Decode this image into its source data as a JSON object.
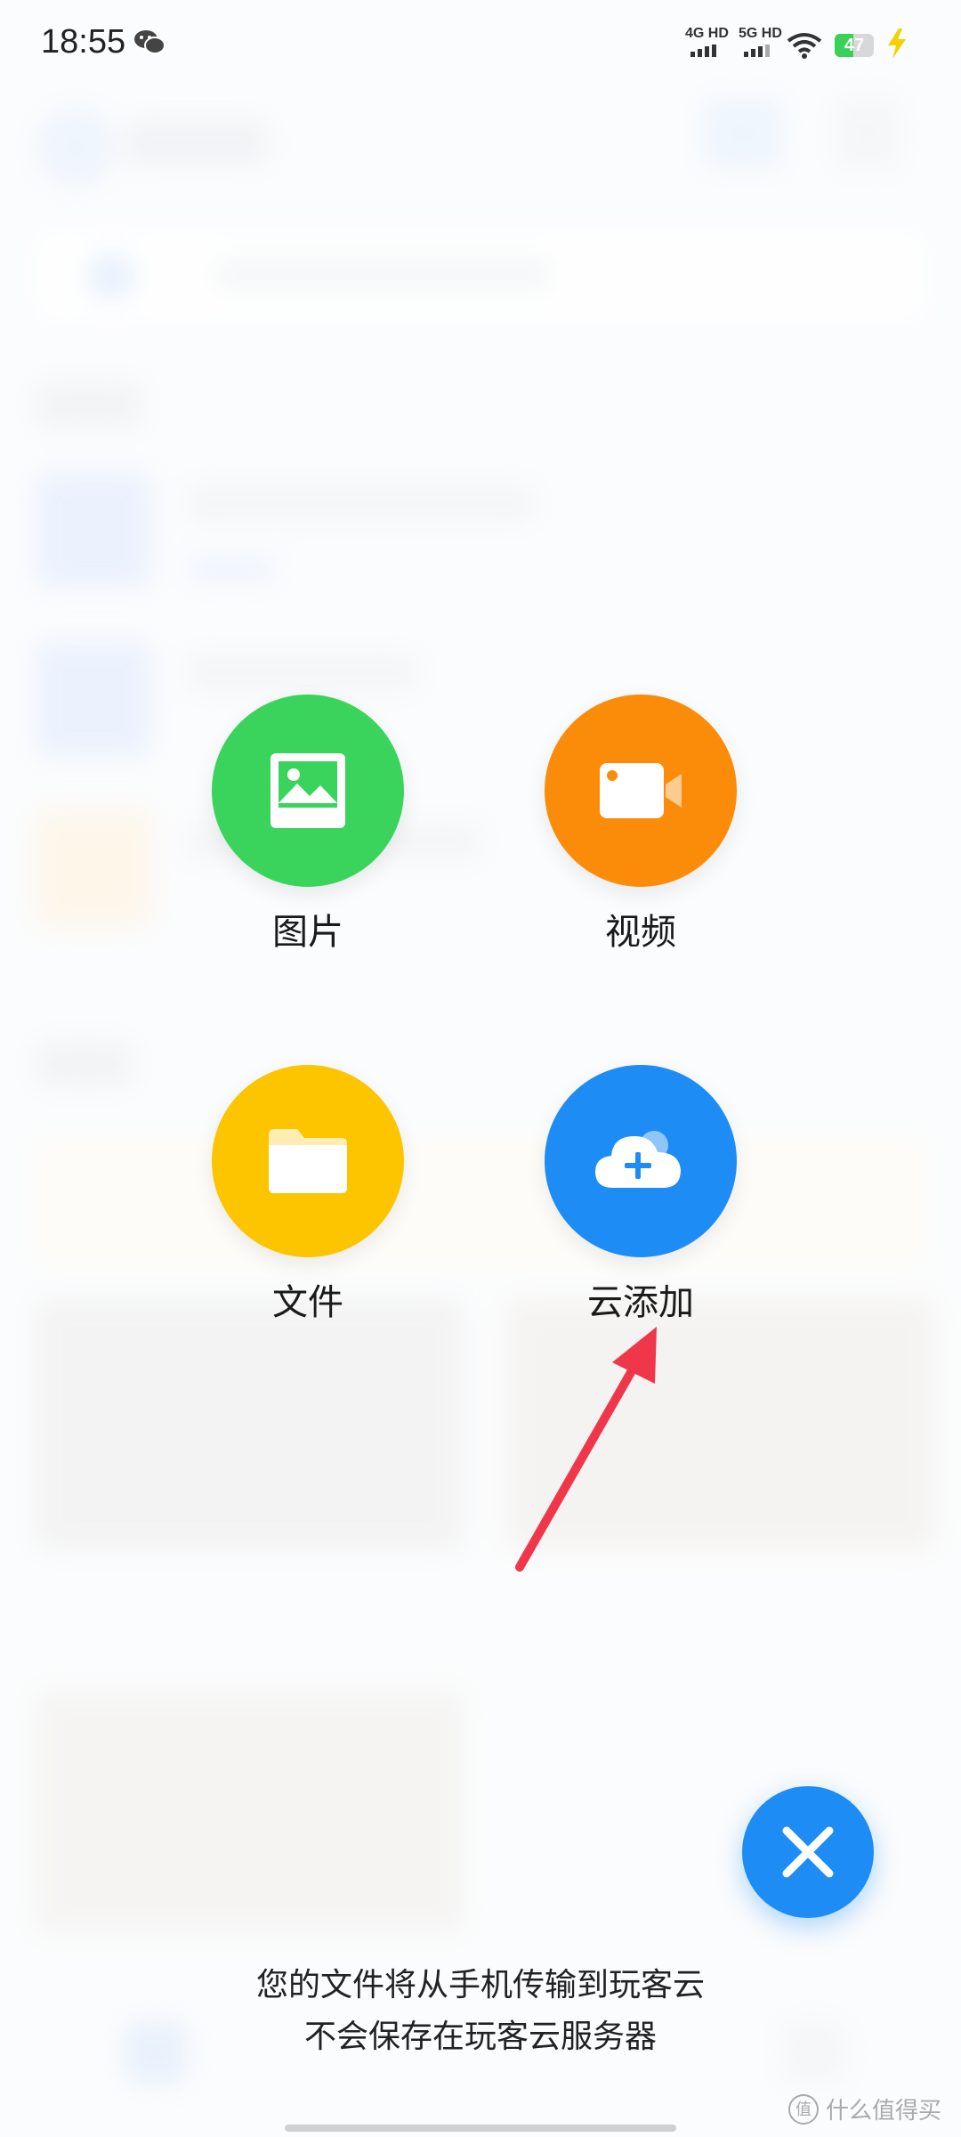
{
  "status_bar": {
    "time": "18:55",
    "network_1": "4G HD",
    "network_2": "5G HD",
    "battery": "47",
    "battery_level": 0.47
  },
  "actions": [
    {
      "id": "image",
      "label": "图片",
      "color": "#3ad45c",
      "icon": "image-icon"
    },
    {
      "id": "video",
      "label": "视频",
      "color": "#fb8c0a",
      "icon": "video-camera-icon"
    },
    {
      "id": "file",
      "label": "文件",
      "color": "#fdc400",
      "icon": "folder-icon"
    },
    {
      "id": "cloud",
      "label": "云添加",
      "color": "#1e8cf5",
      "icon": "cloud-plus-icon"
    }
  ],
  "notice": {
    "line1": "您的文件将从手机传输到玩客云",
    "line2": "不会保存在玩客云服务器"
  },
  "watermark": {
    "text": "什么值得买",
    "logo": "值"
  },
  "colors": {
    "annotation_arrow": "#f0364a",
    "close_button": "#1e8cf5"
  }
}
